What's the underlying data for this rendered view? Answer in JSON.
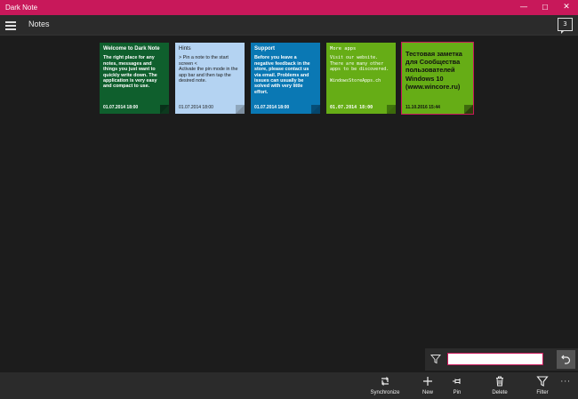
{
  "window": {
    "title": "Dark Note",
    "minimize": "—",
    "maximize": "☐",
    "close": "✕"
  },
  "appbar": {
    "page_title": "Notes",
    "badge_count": "3"
  },
  "notes": [
    {
      "title": "Welcome to Dark Note",
      "body": "The right place for any notes, messages and things you just want to quickly write down. The application is very easy and compact to use.",
      "date": "01.07.2014 18:00",
      "color": "#0f5f2d"
    },
    {
      "title": "Hints",
      "body": "> Pin a note to the start screen <\nActivate the pin mode in the app bar and then tap the desired note.",
      "date": "01.07.2014 18:00",
      "color": "#b4d3f2"
    },
    {
      "title": "Support",
      "body": "Before you leave a negative feedback in the store, please contact us via email. Problems and issues can usually be solved with very little effort.",
      "date": "01.07.2014 18:00",
      "color": "#0a78b4"
    },
    {
      "title": "More apps",
      "body": "Visit our website. There are many other apps to be discovered.\n\nWindowsStoreApps.ch",
      "date": "01.07.2014 18:00",
      "color": "#66ad16"
    },
    {
      "title": "",
      "body": "Тестовая заметка для Сообщества пользователей Windows 10 (www.wincore.ru)",
      "date": "11.10.2016 15:44",
      "color": "#66ad16"
    }
  ],
  "filter": {
    "value": "",
    "placeholder": ""
  },
  "commands": [
    {
      "label": "Synchronize",
      "icon": "sync-icon"
    },
    {
      "label": "New",
      "icon": "plus-icon"
    },
    {
      "label": "Pin",
      "icon": "pin-icon"
    },
    {
      "label": "Delete",
      "icon": "trash-icon"
    },
    {
      "label": "Filter",
      "icon": "filter-icon"
    }
  ],
  "more_label": "···",
  "colors": {
    "accent": "#c8185a",
    "background": "#1c1c1c",
    "bar": "#2b2b2b"
  }
}
